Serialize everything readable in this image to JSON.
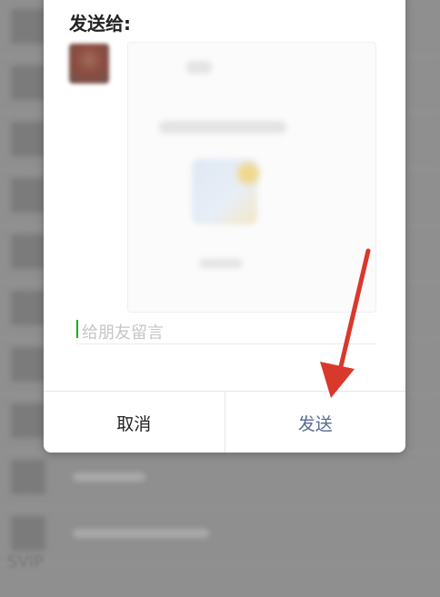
{
  "dialog": {
    "title": "发送给:",
    "message_placeholder": "给朋友留言",
    "cancel_label": "取消",
    "send_label": "发送"
  },
  "background": {
    "bottom_label": "SVIP"
  },
  "colors": {
    "send_text": "#576b95",
    "cursor": "#1aad19",
    "annotation_arrow": "#d9382c"
  }
}
